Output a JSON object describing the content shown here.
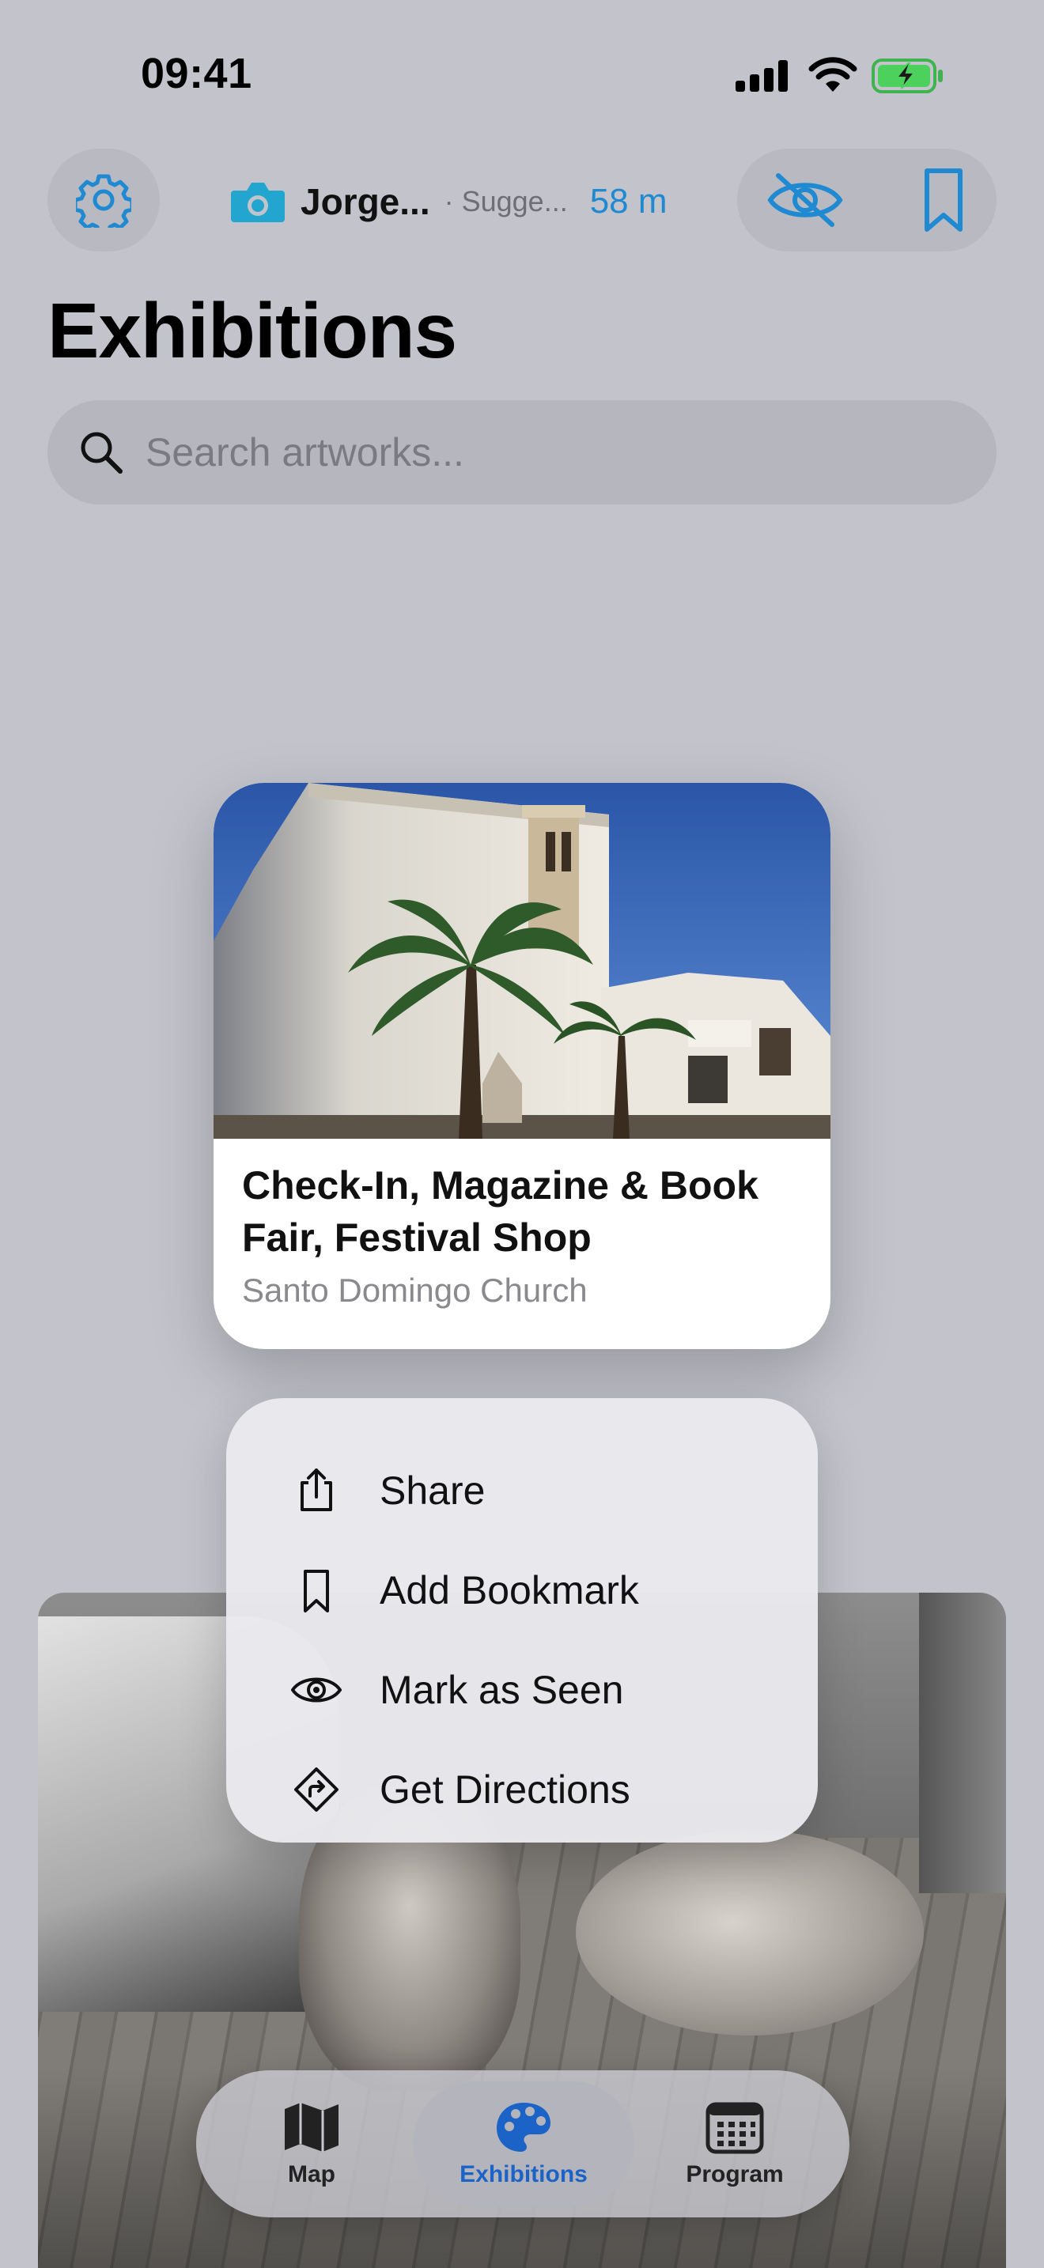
{
  "status_bar": {
    "time": "09:41"
  },
  "toolbar": {
    "settings_icon": "gear-icon",
    "now_playing": {
      "icon": "camera-icon",
      "name": "Jorge...",
      "suggestion": "· Sugge...",
      "distance": "58 m"
    },
    "hide_icon": "eye-slash-icon",
    "bookmark_icon": "bookmark-icon"
  },
  "page": {
    "title": "Exhibitions"
  },
  "search": {
    "placeholder": "Search artworks..."
  },
  "card": {
    "title": "Check-In, Magazine & Book Fair, Festival Shop",
    "venue": "Santo Domingo Church"
  },
  "menu": {
    "items": [
      {
        "label": "Share",
        "icon": "share-icon"
      },
      {
        "label": "Add Bookmark",
        "icon": "bookmark-icon"
      },
      {
        "label": "Mark as Seen",
        "icon": "eye-icon"
      },
      {
        "label": "Get Directions",
        "icon": "directions-icon"
      }
    ]
  },
  "tabbar": {
    "tabs": [
      {
        "label": "Map",
        "icon": "map-icon",
        "active": false
      },
      {
        "label": "Exhibitions",
        "icon": "palette-icon",
        "active": true
      },
      {
        "label": "Program",
        "icon": "calendar-icon",
        "active": false
      }
    ]
  },
  "colors": {
    "accent": "#1F8AD1",
    "tab_active": "#1C63C8",
    "background": "#C3C3CB"
  }
}
